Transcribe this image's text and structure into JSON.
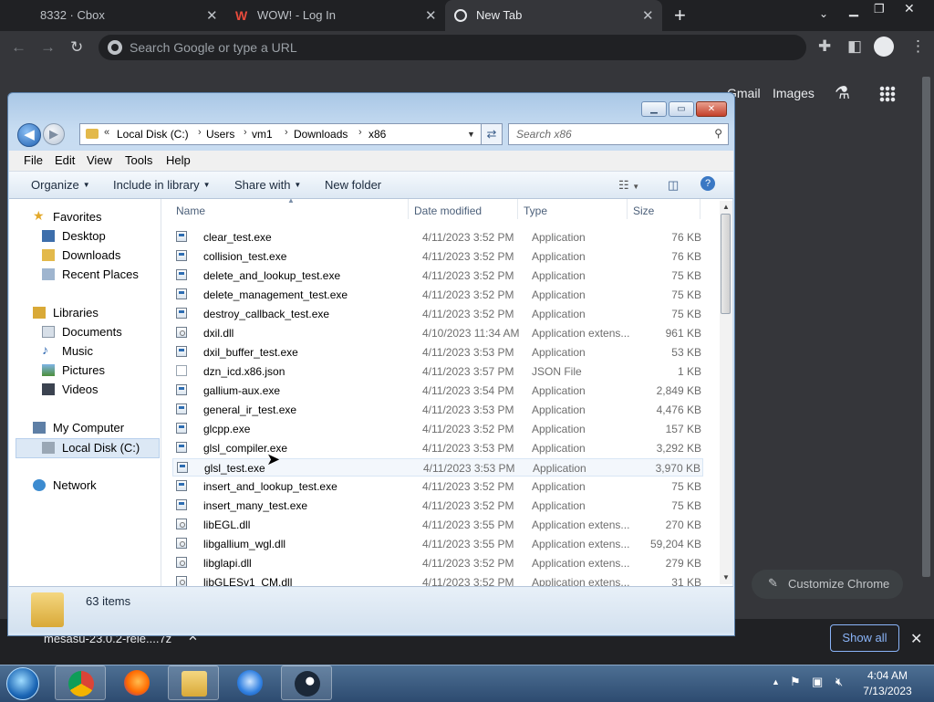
{
  "chrome": {
    "tabs": [
      {
        "title": "8332 · Cbox",
        "favicon": "cbox"
      },
      {
        "title": "WOW! - Log In",
        "favicon": "w-logo"
      },
      {
        "title": "New Tab",
        "favicon": "chrome-logo"
      }
    ],
    "new_tab_symbol": "+",
    "omnibox_placeholder": "Search Google or type a URL",
    "ntp_links": {
      "gmail": "Gmail",
      "images": "Images"
    },
    "customize_label": "Customize Chrome",
    "download_item": "mesasu-23.0.2-rele....7z",
    "show_all_label": "Show all"
  },
  "explorer": {
    "breadcrumbs": [
      "Local Disk (C:)",
      "Users",
      "vm1",
      "Downloads",
      "x86"
    ],
    "search_placeholder": "Search x86",
    "menu": [
      "File",
      "Edit",
      "View",
      "Tools",
      "Help"
    ],
    "commands": {
      "organize": "Organize",
      "include": "Include in library",
      "share": "Share with",
      "new_folder": "New folder"
    },
    "nav": {
      "favorites": "Favorites",
      "desktop": "Desktop",
      "downloads": "Downloads",
      "recent": "Recent Places",
      "libraries": "Libraries",
      "documents": "Documents",
      "music": "Music",
      "pictures": "Pictures",
      "videos": "Videos",
      "computer": "My Computer",
      "local_disk": "Local Disk (C:)",
      "network": "Network"
    },
    "columns": {
      "name": "Name",
      "date": "Date modified",
      "type": "Type",
      "size": "Size"
    },
    "files": [
      {
        "name": "clear_test.exe",
        "date": "4/11/2023 3:52 PM",
        "type": "Application",
        "size": "76 KB",
        "icon": "app"
      },
      {
        "name": "collision_test.exe",
        "date": "4/11/2023 3:52 PM",
        "type": "Application",
        "size": "76 KB",
        "icon": "app"
      },
      {
        "name": "delete_and_lookup_test.exe",
        "date": "4/11/2023 3:52 PM",
        "type": "Application",
        "size": "75 KB",
        "icon": "app"
      },
      {
        "name": "delete_management_test.exe",
        "date": "4/11/2023 3:52 PM",
        "type": "Application",
        "size": "75 KB",
        "icon": "app"
      },
      {
        "name": "destroy_callback_test.exe",
        "date": "4/11/2023 3:52 PM",
        "type": "Application",
        "size": "75 KB",
        "icon": "app"
      },
      {
        "name": "dxil.dll",
        "date": "4/10/2023 11:34 AM",
        "type": "Application extens...",
        "size": "961 KB",
        "icon": "dll"
      },
      {
        "name": "dxil_buffer_test.exe",
        "date": "4/11/2023 3:53 PM",
        "type": "Application",
        "size": "53 KB",
        "icon": "app"
      },
      {
        "name": "dzn_icd.x86.json",
        "date": "4/11/2023 3:57 PM",
        "type": "JSON File",
        "size": "1 KB",
        "icon": "doc"
      },
      {
        "name": "gallium-aux.exe",
        "date": "4/11/2023 3:54 PM",
        "type": "Application",
        "size": "2,849 KB",
        "icon": "app"
      },
      {
        "name": "general_ir_test.exe",
        "date": "4/11/2023 3:53 PM",
        "type": "Application",
        "size": "4,476 KB",
        "icon": "app"
      },
      {
        "name": "glcpp.exe",
        "date": "4/11/2023 3:52 PM",
        "type": "Application",
        "size": "157 KB",
        "icon": "app"
      },
      {
        "name": "glsl_compiler.exe",
        "date": "4/11/2023 3:53 PM",
        "type": "Application",
        "size": "3,292 KB",
        "icon": "app"
      },
      {
        "name": "glsl_test.exe",
        "date": "4/11/2023 3:53 PM",
        "type": "Application",
        "size": "3,970 KB",
        "icon": "app"
      },
      {
        "name": "insert_and_lookup_test.exe",
        "date": "4/11/2023 3:52 PM",
        "type": "Application",
        "size": "75 KB",
        "icon": "app"
      },
      {
        "name": "insert_many_test.exe",
        "date": "4/11/2023 3:52 PM",
        "type": "Application",
        "size": "75 KB",
        "icon": "app"
      },
      {
        "name": "libEGL.dll",
        "date": "4/11/2023 3:55 PM",
        "type": "Application extens...",
        "size": "270 KB",
        "icon": "dll"
      },
      {
        "name": "libgallium_wgl.dll",
        "date": "4/11/2023 3:55 PM",
        "type": "Application extens...",
        "size": "59,204 KB",
        "icon": "dll"
      },
      {
        "name": "libglapi.dll",
        "date": "4/11/2023 3:52 PM",
        "type": "Application extens...",
        "size": "279 KB",
        "icon": "dll"
      },
      {
        "name": "libGLESv1_CM.dll",
        "date": "4/11/2023 3:52 PM",
        "type": "Application extens...",
        "size": "31 KB",
        "icon": "dll"
      }
    ],
    "status": "63 items"
  },
  "taskbar": {
    "apps": [
      "chrome",
      "firefox",
      "file-explorer",
      "thunderbird",
      "steam"
    ],
    "time": "4:04 AM",
    "date": "7/13/2023"
  }
}
